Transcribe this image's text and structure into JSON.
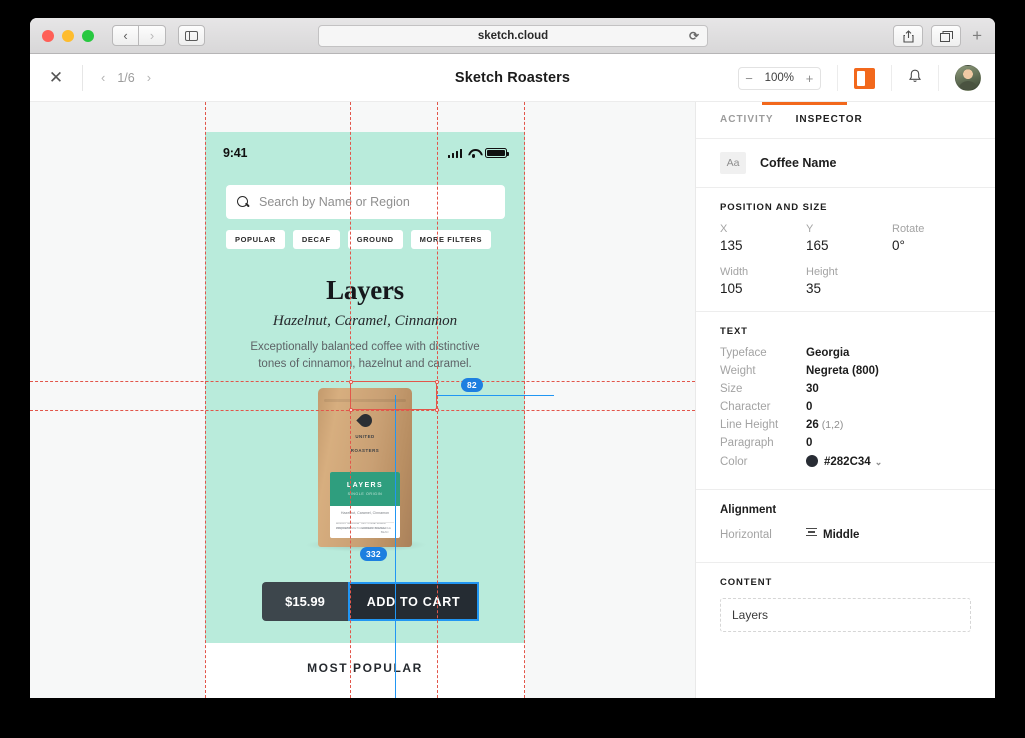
{
  "browser": {
    "url": "sketch.cloud",
    "reload_icon": "reload-icon",
    "back_icon": "‹",
    "forward_icon": "›",
    "sidebar_icon": "sidebar-icon",
    "share_icon": "share-icon",
    "tabs_icon": "tabs-icon",
    "new_tab_icon": "+"
  },
  "toolbar": {
    "close_label": "✕",
    "prev_label": "‹",
    "next_label": "›",
    "page_indicator": "1/6",
    "title": "Sketch Roasters",
    "zoom_out": "−",
    "zoom_value": "100%",
    "zoom_in": "+",
    "panel_toggle_icon": "panel-toggle-icon",
    "panel_toggle_color": "#f2681c",
    "bell_icon": "bell-icon",
    "avatar_icon": "avatar"
  },
  "inspector": {
    "tabs": [
      {
        "label": "ACTIVITY",
        "active": false
      },
      {
        "label": "INSPECTOR",
        "active": true
      }
    ],
    "layer": {
      "icon": "Aa",
      "name": "Coffee Name"
    },
    "position_and_size": {
      "title": "POSITION AND SIZE",
      "x_label": "X",
      "x_value": "135",
      "y_label": "Y",
      "y_value": "165",
      "rotate_label": "Rotate",
      "rotate_value": "0°",
      "width_label": "Width",
      "width_value": "105",
      "height_label": "Height",
      "height_value": "35"
    },
    "text": {
      "title": "TEXT",
      "rows": [
        {
          "key": "Typeface",
          "value": "Georgia",
          "sub": ""
        },
        {
          "key": "Weight",
          "value": "Negreta (800)",
          "sub": ""
        },
        {
          "key": "Size",
          "value": "30",
          "sub": ""
        },
        {
          "key": "Character",
          "value": "0",
          "sub": ""
        },
        {
          "key": "Line Height",
          "value": "26",
          "sub": "(1,2)"
        },
        {
          "key": "Paragraph",
          "value": "0",
          "sub": ""
        }
      ],
      "color_label": "Color",
      "color_value": "#282C34",
      "color_hex": "#282C34"
    },
    "alignment": {
      "title": "Alignment",
      "horizontal_label": "Horizontal",
      "horizontal_value": "Middle"
    },
    "content": {
      "title": "CONTENT",
      "value": "Layers"
    }
  },
  "canvas": {
    "background": "#f7f8f8",
    "guide_color": "#e2564a",
    "measure_color": "#2196f3",
    "badges": [
      {
        "id": "width-badge",
        "value": "82"
      },
      {
        "id": "bag-badge",
        "value": "332"
      }
    ]
  },
  "mockup": {
    "background": "#b9ebdb",
    "status_bar": {
      "time": "9:41",
      "signal_icon": "signal-icon",
      "wifi_icon": "wifi-icon",
      "battery_icon": "battery-icon"
    },
    "search": {
      "placeholder": "Search by Name or Region",
      "icon": "search-icon"
    },
    "filters": [
      "POPULAR",
      "DECAF",
      "GROUND",
      "MORE FILTERS"
    ],
    "product": {
      "title": "Layers",
      "subtitle": "Hazelnut, Caramel, Cinnamon",
      "description": "Exceptionally balanced coffee with distinctive tones of cinnamon, hazelnut and caramel.",
      "bag_brand_line1": "UNITED",
      "bag_brand_line2": "ROASTERS",
      "bag_label_title": "LAYERS",
      "bag_label_sub": "SINGLE ORIGIN",
      "bag_label_notes": "Hazelnut, Caramel, Cinnamon",
      "bag_label_left": "ROAST\nMEDIUM\nPROCESS",
      "bag_label_right": "ALTITUDE 1800M\nVARIETY Bourbon",
      "bag_label_weight": "340g",
      "bag_label_site": "WWW.SKETCHCOFFEE.COM",
      "bag_label_type": "WHOLE BEAN"
    },
    "cta": {
      "price": "$15.99",
      "button": "ADD TO CART"
    },
    "footer_heading": "MOST POPULAR"
  }
}
